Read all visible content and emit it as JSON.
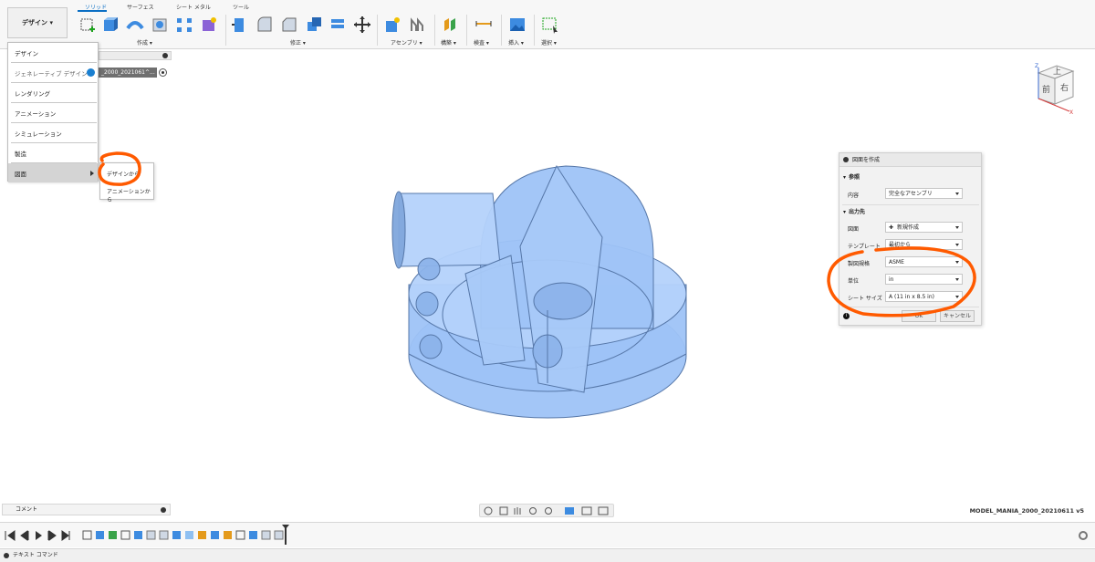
{
  "workspace_button": {
    "label": "デザイン ▾"
  },
  "tabs": [
    {
      "label": "ソリッド",
      "active": true
    },
    {
      "label": "サーフェス",
      "active": false
    },
    {
      "label": "シート メタル",
      "active": false
    },
    {
      "label": "ツール",
      "active": false
    }
  ],
  "tool_groups": [
    {
      "label": "作成 ▾"
    },
    {
      "label": "修正 ▾"
    },
    {
      "label": "アセンブリ ▾"
    },
    {
      "label": "構築 ▾"
    },
    {
      "label": "検査 ▾"
    },
    {
      "label": "挿入 ▾"
    },
    {
      "label": "選択 ▾"
    }
  ],
  "browser": {
    "doc_chip": "_2000_2021061^..."
  },
  "workspace_menu": {
    "items": [
      {
        "label": "デザイン"
      },
      {
        "label": "ジェネレーティブ デザイン"
      },
      {
        "label": "レンダリング"
      },
      {
        "label": "アニメーション"
      },
      {
        "label": "シミュレーション"
      },
      {
        "label": "製造"
      },
      {
        "label": "図面"
      }
    ]
  },
  "drawing_submenu": {
    "items": [
      {
        "label": "デザインから"
      },
      {
        "label": "アニメーションから"
      }
    ]
  },
  "dialog": {
    "title": "図面を作成",
    "sections": {
      "reference": "参照",
      "output": "出力先"
    },
    "rows": [
      {
        "label": "内容",
        "value": "完全なアセンブリ"
      },
      {
        "label": "図面",
        "value": "新規作成"
      },
      {
        "label": "テンプレート",
        "value": "最初から"
      },
      {
        "label": "製図規格",
        "value": "ASME"
      },
      {
        "label": "単位",
        "value": "in"
      },
      {
        "label": "シート サイズ",
        "value": "A (11 in x 8.5 in)"
      }
    ],
    "ok_label": "OK",
    "cancel_label": "キャンセル"
  },
  "viewcube": {
    "top_face": "上",
    "front_face": "前",
    "right_face": "右",
    "axis_x": "X",
    "axis_z": "Z"
  },
  "comments": {
    "label": "コメント"
  },
  "document_version": "MODEL_MANIA_2000_20210611 v5",
  "text_command": "テキスト コマンド",
  "colors": {
    "accent": "#0b6fc4",
    "model": "#9ec3f7",
    "annotation": "#ff5a00"
  }
}
